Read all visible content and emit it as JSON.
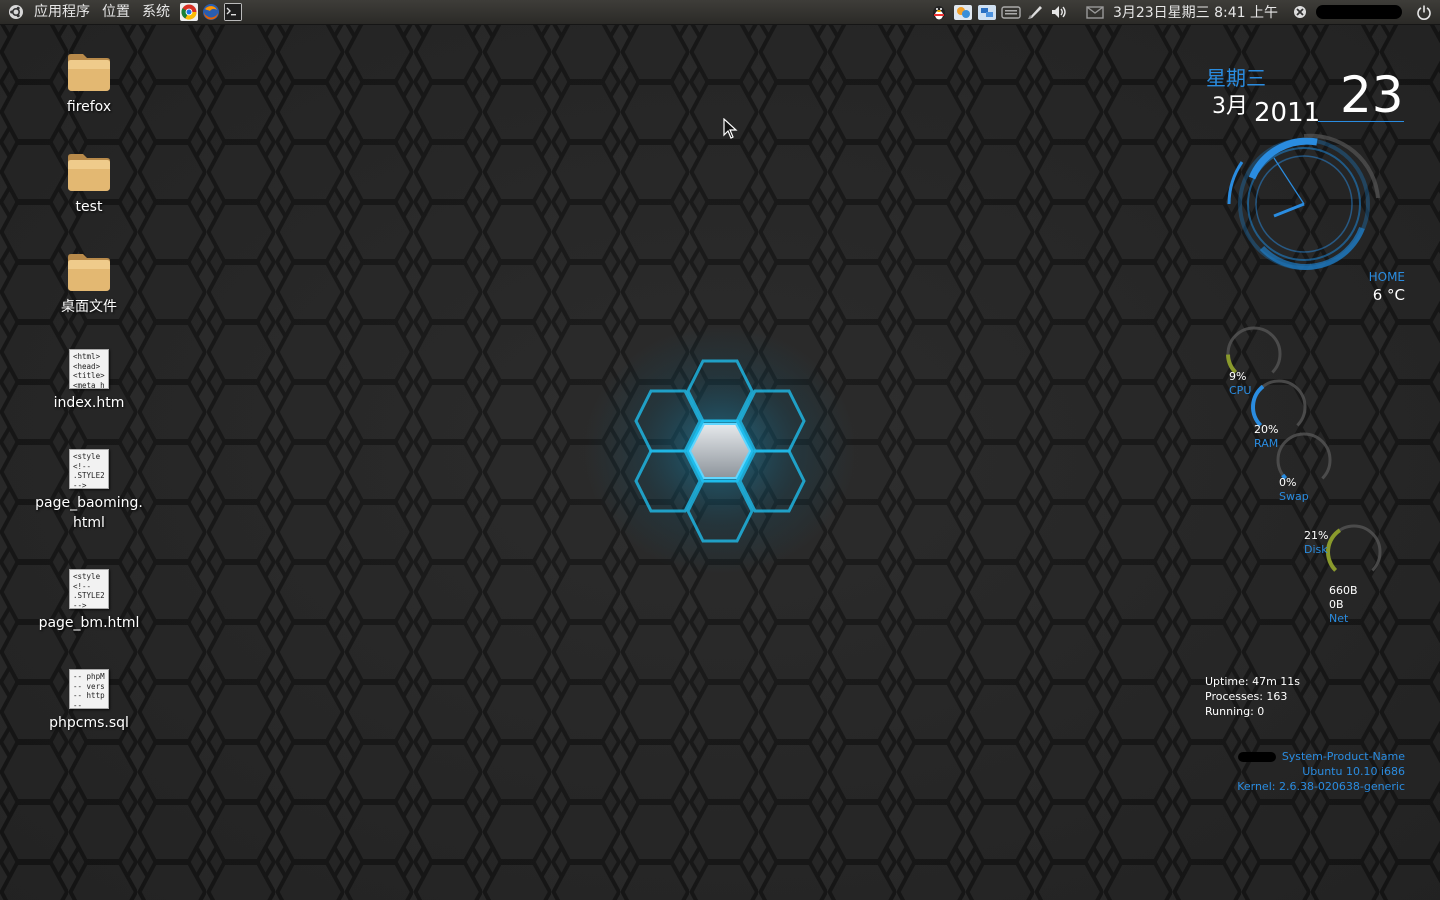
{
  "panel": {
    "menu_applications": "应用程序",
    "menu_places": "位置",
    "menu_system": "系统",
    "launchers": [
      "chrome-icon",
      "firefox-icon",
      "terminal-icon"
    ],
    "tray_icons": [
      "qq-penguin-icon",
      "messenger-icon",
      "network-icon",
      "keyboard-icon",
      "pen-icon",
      "volume-icon",
      "mail-icon"
    ],
    "clock": "3月23日星期三 8:41 上午"
  },
  "desktop": {
    "icons": [
      {
        "label": "firefox",
        "type": "folder"
      },
      {
        "label": "test",
        "type": "folder"
      },
      {
        "label": "桌面文件",
        "type": "folder"
      },
      {
        "label": "index.htm",
        "type": "document",
        "preview": "<html>\n<head>\n<title>\n<meta h"
      },
      {
        "label": "page_baoming.\nhtml",
        "type": "document",
        "preview": "<style\n<!--\n.STYLE2\n-->"
      },
      {
        "label": "page_bm.html",
        "type": "document",
        "preview": "<style\n<!--\n.STYLE2\n-->"
      },
      {
        "label": "phpcms.sql",
        "type": "document",
        "preview": "-- phpM\n-- vers\n-- http\n--"
      }
    ]
  },
  "conky": {
    "weekday": "星期三",
    "month": "3月",
    "year": "2011",
    "day": "23",
    "location": "HOME",
    "temperature": "6 °C",
    "cpu": {
      "value": "9%",
      "label": "CPU",
      "fraction": 0.09
    },
    "ram": {
      "value": "20%",
      "label": "RAM",
      "fraction": 0.2
    },
    "swap": {
      "value": "0%",
      "label": "Swap",
      "fraction": 0.0
    },
    "disk": {
      "value": "21%",
      "label": "Disk",
      "fraction": 0.21
    },
    "net": {
      "down": "660B",
      "up": "0B",
      "label": "Net"
    },
    "uptime": "Uptime: 47m 11s",
    "processes": "Processes: 163",
    "running": "Running: 0",
    "product": "System-Product-Name",
    "os": "Ubuntu 10.10  i686",
    "kernel": "Kernel: 2.6.38-020638-generic"
  },
  "colors": {
    "accent": "#2a8ce0",
    "glow": "#19b8ee",
    "panel": "#3a3935"
  }
}
